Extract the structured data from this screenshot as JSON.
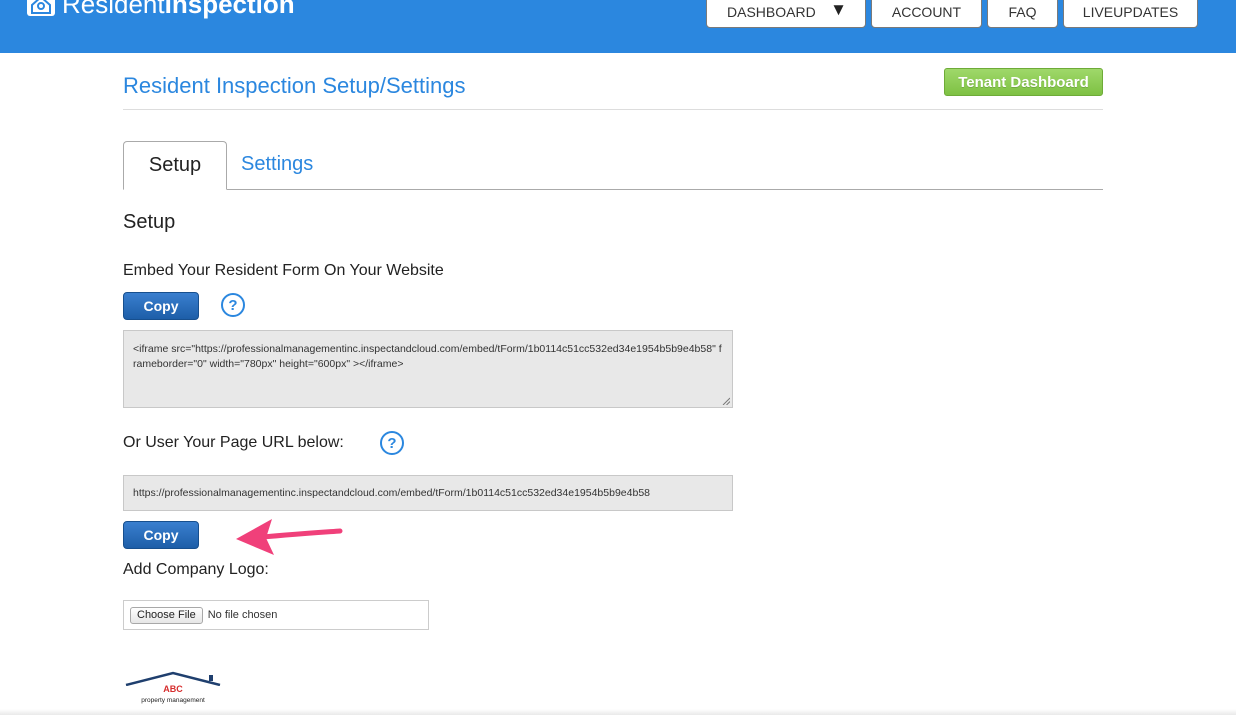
{
  "header": {
    "logo_part1": "Resident",
    "logo_part2": "Inspection",
    "nav": {
      "dashboard": "DASHBOARD",
      "dashboard_caret": "▼",
      "account": "ACCOUNT",
      "faq": "FAQ",
      "liveupdates": "LIVEUPDATES"
    },
    "bar_color": "#2b87df"
  },
  "page": {
    "title": "Resident Inspection Setup/Settings",
    "tenant_dashboard_label": "Tenant Dashboard"
  },
  "tabs": {
    "setup": "Setup",
    "settings": "Settings",
    "active": "Setup"
  },
  "setup": {
    "heading": "Setup",
    "embed_label": "Embed Your Resident Form On Your Website",
    "copy_label": "Copy",
    "help_glyph": "?",
    "embed_code": "<iframe src=\"https://professionalmanagementinc.inspectandcloud.com/embed/tForm/1b0114c51cc532ed34e1954b5b9e4b58\" frameborder=\"0\" width=\"780px\" height=\"600px\" ></iframe>",
    "url_label": "Or User Your Page URL below:",
    "page_url": "https://professionalmanagementinc.inspectandcloud.com/embed/tForm/1b0114c51cc532ed34e1954b5b9e4b58",
    "copy_label_2": "Copy",
    "logo_label": "Add Company Logo:",
    "choose_file_label": "Choose File",
    "no_file_text": "No file chosen"
  },
  "company_logo": {
    "name": "ABC",
    "tagline": "property management"
  },
  "colors": {
    "accent": "#2b87df",
    "copy_button": "#1d5ea8",
    "tenant_button": "#7ec143",
    "annotation_arrow": "#f0407a"
  }
}
